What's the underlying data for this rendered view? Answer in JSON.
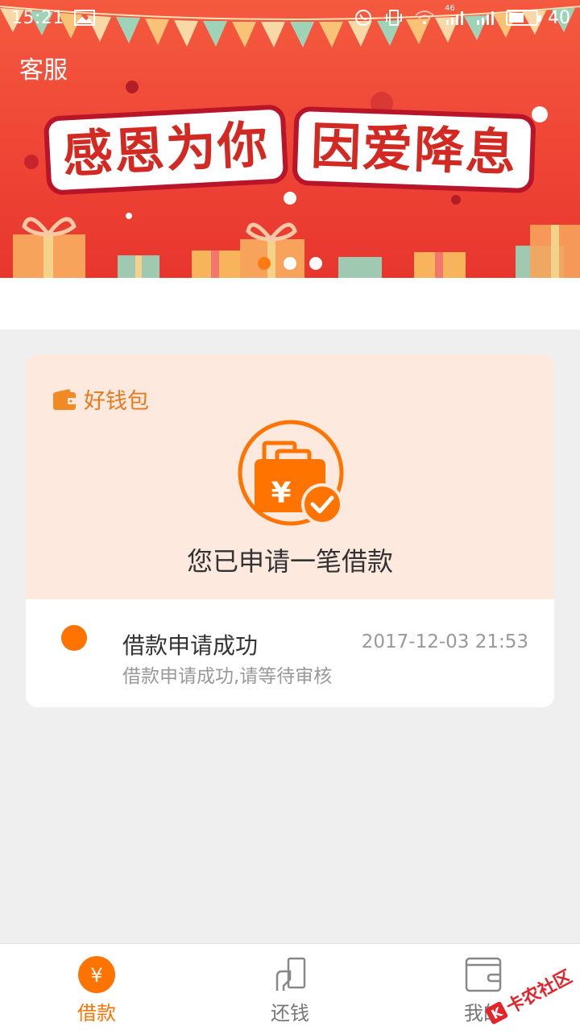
{
  "status_bar": {
    "time": "15:21",
    "signal_label": "46",
    "battery": "40"
  },
  "banner": {
    "service_label": "客服",
    "headline_part1": "感恩为你",
    "headline_part2": "因爱降息",
    "carousel_active_index": 0,
    "carousel_count": 3
  },
  "card": {
    "brand_name": "好钱包",
    "status_text": "您已申请一笔借款",
    "timeline": {
      "title": "借款申请成功",
      "time": "2017-12-03 21:53",
      "description": "借款申请成功,请等待审核"
    }
  },
  "tabbar": {
    "tabs": [
      {
        "label": "借款",
        "icon": "yen-circle-icon",
        "active": true
      },
      {
        "label": "还钱",
        "icon": "repay-icon",
        "active": false
      },
      {
        "label": "我的",
        "icon": "wallet-icon",
        "active": false
      }
    ]
  },
  "watermark": {
    "text": "卡农社区"
  },
  "colors": {
    "accent": "#ff7300",
    "banner_red": "#ef4536",
    "card_peach": "#fde9de"
  }
}
